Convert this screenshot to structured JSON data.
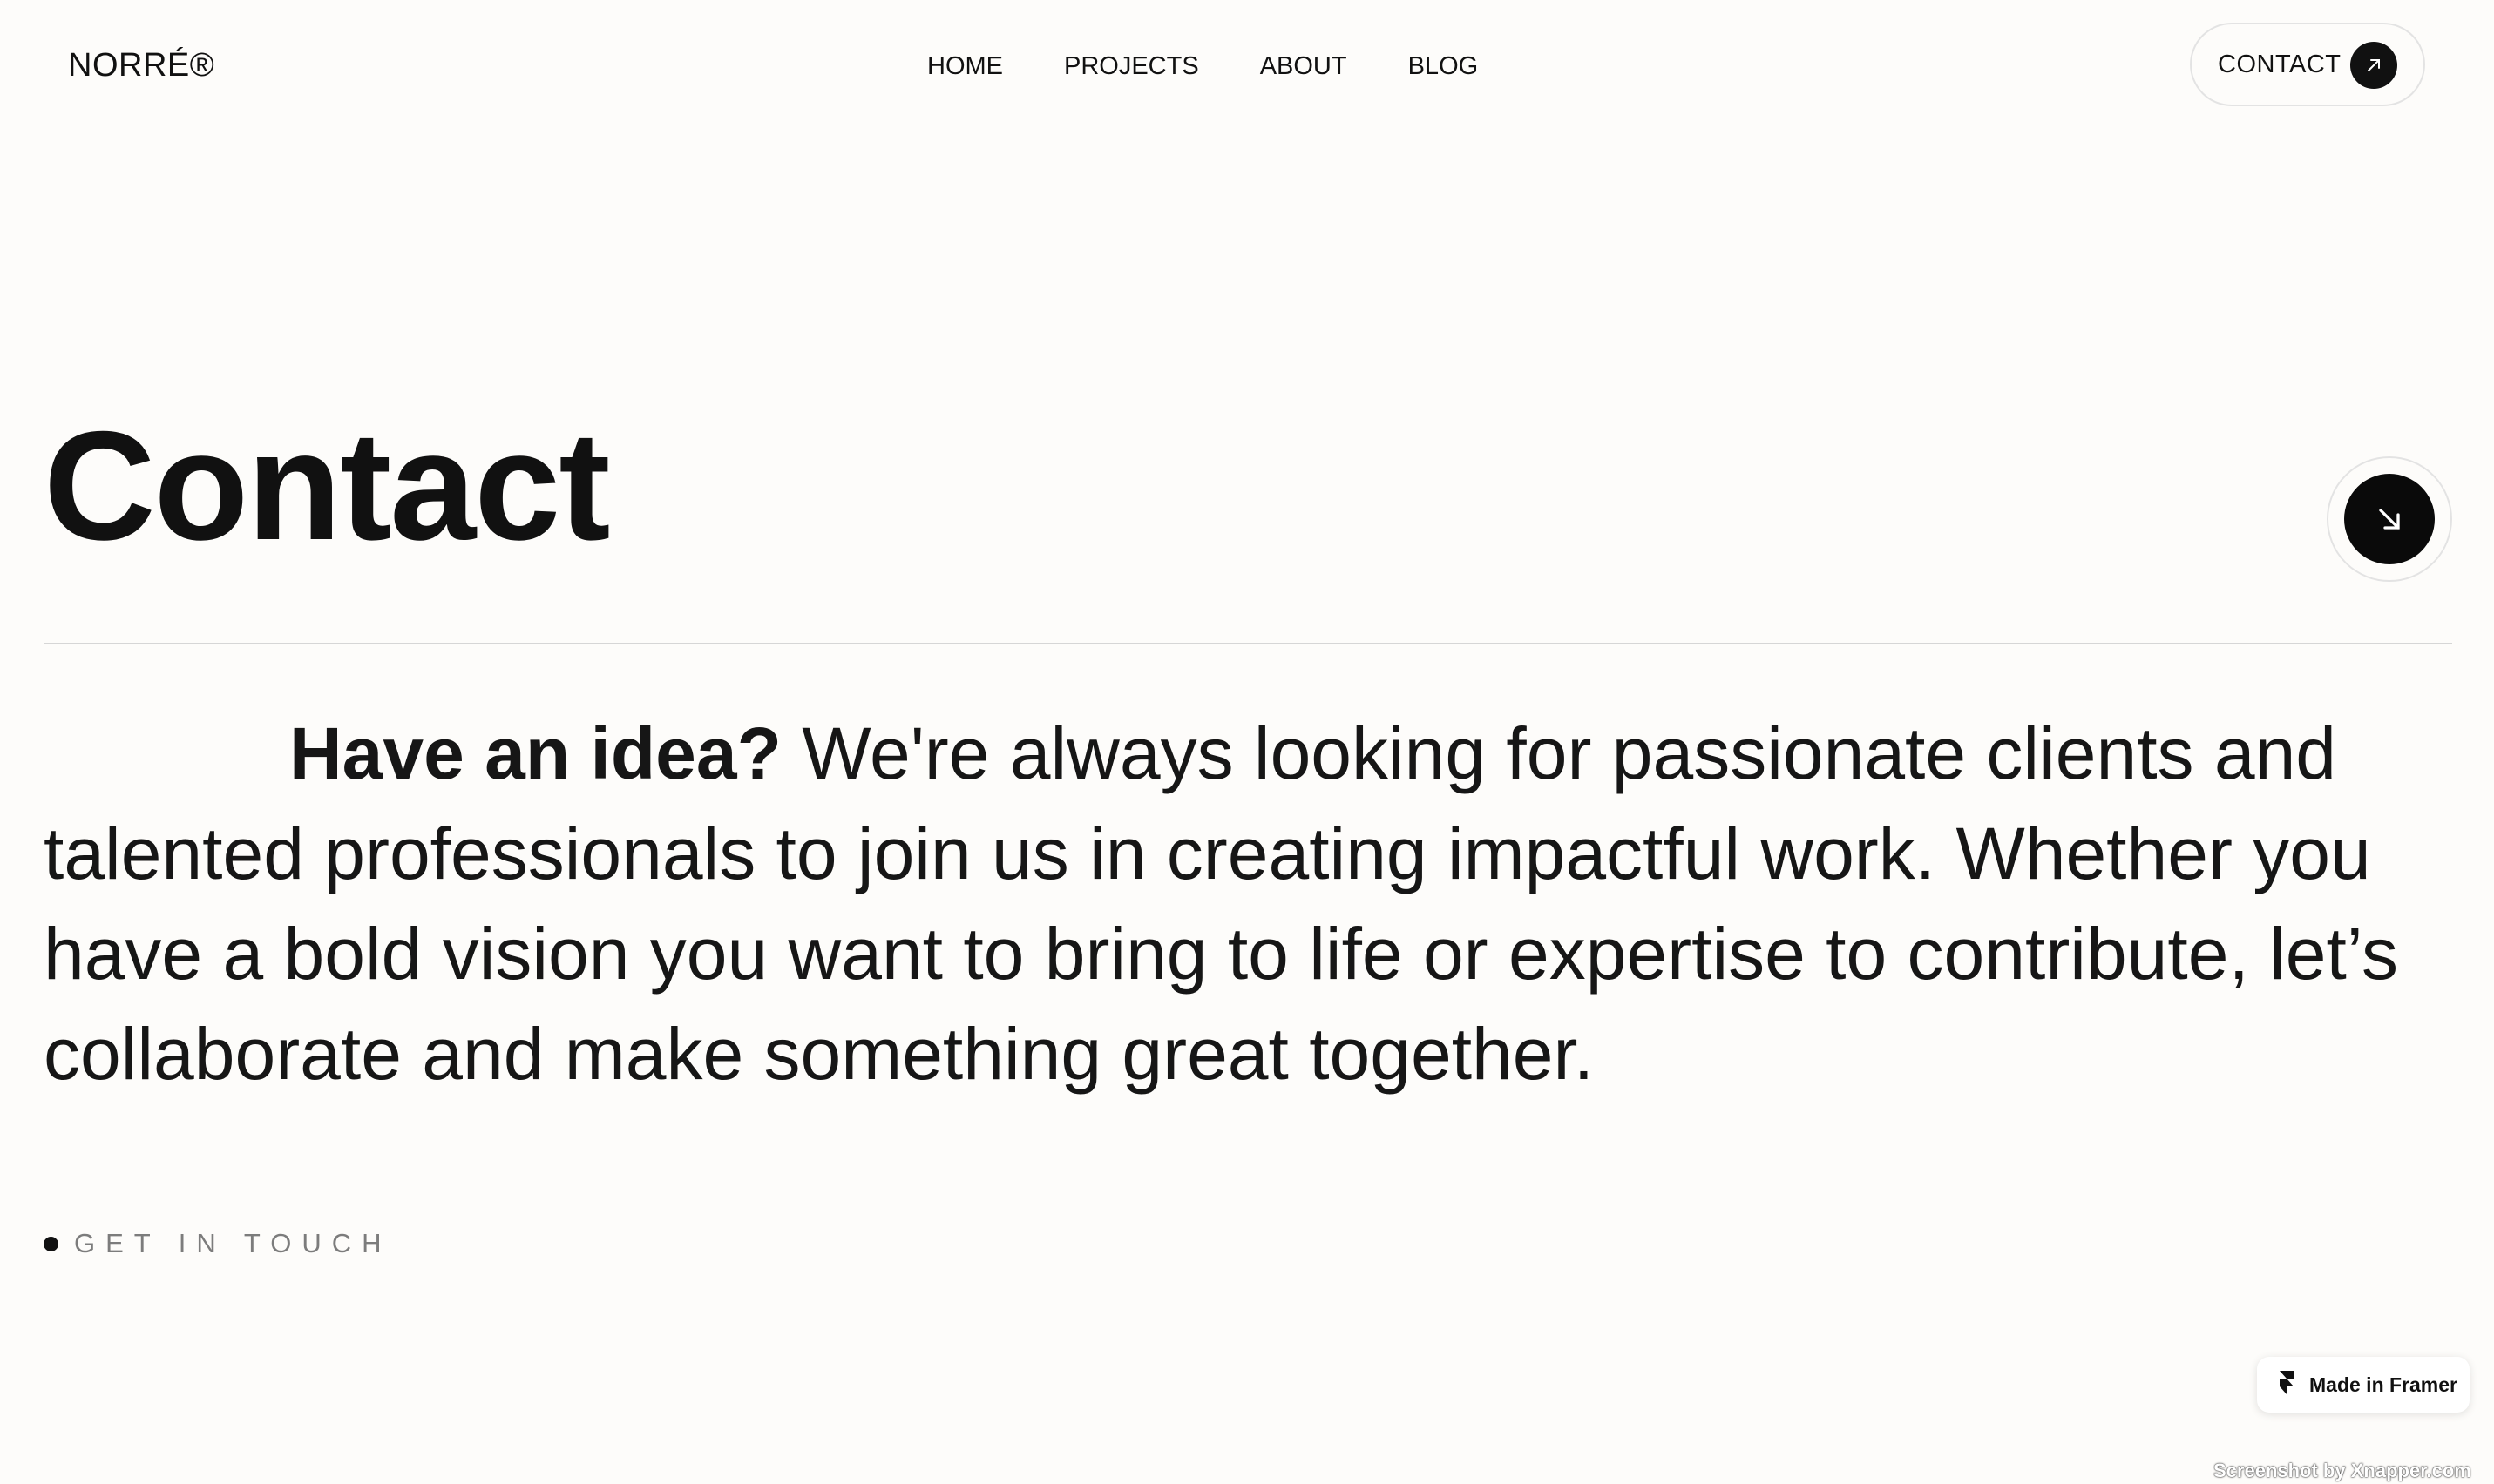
{
  "header": {
    "logo": "NORRÉ®",
    "nav": [
      {
        "label": "HOME"
      },
      {
        "label": "PROJECTS"
      },
      {
        "label": "ABOUT"
      },
      {
        "label": "BLOG"
      }
    ],
    "contact_button": {
      "label": "CONTACT",
      "icon": "arrow-up-right-icon"
    }
  },
  "hero": {
    "title": "Contact",
    "scroll_button_icon": "arrow-down-right-icon"
  },
  "intro": {
    "lead": "Have an idea?",
    "body": " We're always looking for passionate clients and talented professionals to join us in creating impactful work. Whether you have a bold vision you want to bring to life or expertise to contribute, let’s collaborate and make something great together."
  },
  "cta": {
    "label": "GET IN TOUCH"
  },
  "badge": {
    "label": "Made in Framer",
    "icon": "framer-icon"
  },
  "watermark": "Screenshot by Xnapper.com",
  "colors": {
    "background": "#fdfcfa",
    "text": "#111111",
    "muted": "#7c7c7c",
    "accent": "#0a0a0a"
  }
}
